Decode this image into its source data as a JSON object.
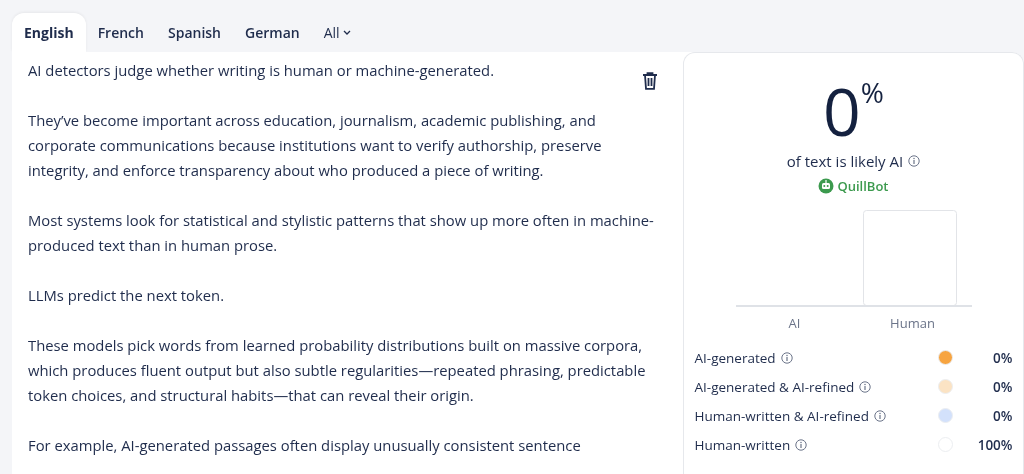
{
  "tabs": [
    {
      "label": "English",
      "selected": true,
      "kind": "tab"
    },
    {
      "label": "French",
      "selected": false,
      "kind": "tab"
    },
    {
      "label": "Spanish",
      "selected": false,
      "kind": "tab"
    },
    {
      "label": "German",
      "selected": false,
      "kind": "tab"
    },
    {
      "label": "All",
      "selected": false,
      "kind": "dropdown"
    }
  ],
  "editor": {
    "paragraphs": [
      "AI detectors judge whether writing is human or machine-generated.",
      "They’ve become important across education, journalism, academic publishing, and corporate communications because institutions want to verify authorship, preserve integrity, and enforce transparency about who produced a piece of writing.",
      "Most systems look for statistical and stylistic patterns that show up more often in machine-produced text than in human prose.",
      "LLMs predict the next token.",
      "These models pick words from learned probability distributions built on massive corpora, which produces fluent output but also subtle regularities—repeated phrasing, predictable token choices, and structural habits—that can reveal their origin.",
      "For example, AI-generated passages often display unusually consistent sentence"
    ]
  },
  "result": {
    "score": "0",
    "unit": "%",
    "caption": "of text is likely AI",
    "brand": "QuillBot",
    "chart": {
      "labels": [
        "AI",
        "Human"
      ]
    },
    "legend": [
      {
        "label": "AI-generated",
        "color": "#f7a440",
        "value": "0%"
      },
      {
        "label": "AI-generated & AI-refined",
        "color": "#fbe3c4",
        "value": "0%"
      },
      {
        "label": "Human-written & AI-refined",
        "color": "#d3e1fb",
        "value": "0%"
      },
      {
        "label": "Human-written",
        "color": "#ffffff",
        "value": "100%"
      }
    ]
  }
}
